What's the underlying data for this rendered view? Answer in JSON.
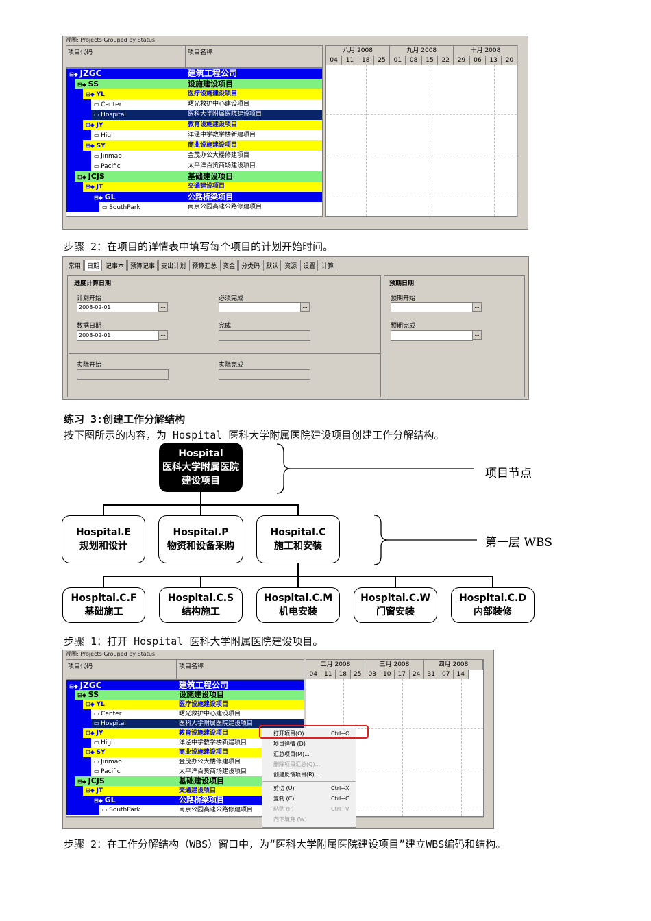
{
  "screenshot1": {
    "title": "视图: Projects Grouped by Status",
    "col_code": "项目代码",
    "col_name": "项目名称",
    "months": [
      "八月 2008",
      "九月 2008",
      "十月 2008"
    ],
    "days": [
      "04",
      "11",
      "18",
      "25",
      "01",
      "08",
      "15",
      "22",
      "29",
      "06",
      "13",
      "20"
    ],
    "rows": [
      {
        "code": "JZGC",
        "name": "建筑工程公司",
        "style": "blue",
        "level": 0
      },
      {
        "code": "SS",
        "name": "设施建设项目",
        "style": "green",
        "level": 1
      },
      {
        "code": "YL",
        "name": "医疗设施建设项目",
        "style": "yellow",
        "level": 2
      },
      {
        "code": "Center",
        "name": "曙光救护中心建设项目",
        "style": "white",
        "level": 3
      },
      {
        "code": "Hospital",
        "name": "医科大学附属医院建设项目",
        "style": "sel",
        "level": 3
      },
      {
        "code": "JY",
        "name": "教育设施建设项目",
        "style": "yellow",
        "level": 2
      },
      {
        "code": "High",
        "name": "洋泾中学教学楼新建项目",
        "style": "white",
        "level": 3
      },
      {
        "code": "SY",
        "name": "商业设施建设项目",
        "style": "yellow",
        "level": 2
      },
      {
        "code": "Jinmao",
        "name": "金茂办公大楼修建项目",
        "style": "white",
        "level": 3
      },
      {
        "code": "Pacific",
        "name": "太平洋百货商场建设项目",
        "style": "white",
        "level": 3
      },
      {
        "code": "JCJS",
        "name": "基础建设项目",
        "style": "green",
        "level": 1
      },
      {
        "code": "JT",
        "name": "交通建设项目",
        "style": "yellow",
        "level": 2
      },
      {
        "code": "GL",
        "name": "公路桥梁项目",
        "style": "blue",
        "level": 3
      },
      {
        "code": "SouthPark",
        "name": "南京公园高速公路修建项目",
        "style": "white",
        "level": 4
      }
    ]
  },
  "step2_text": "步骤 2：在项目的详情表中填写每个项目的计划开始时间。",
  "details": {
    "tabs": [
      "常用",
      "日期",
      "记事本",
      "预算记事",
      "支出计划",
      "预算汇总",
      "资金",
      "分类码",
      "默认",
      "资源",
      "设置",
      "计算"
    ],
    "active_tab": "日期",
    "section_schedule": "进度计算日期",
    "section_expected": "预期日期",
    "plan_start_label": "计划开始",
    "plan_start_value": "2008-02-01",
    "must_finish_label": "必须完成",
    "data_date_label": "数据日期",
    "data_date_value": "2008-02-01",
    "finish_label": "完成",
    "actual_start_label": "实际开始",
    "actual_finish_label": "实际完成",
    "expected_start_label": "预期开始",
    "expected_finish_label": "预期完成",
    "ellipsis": "..."
  },
  "exercise_title": "练习 3:创建工作分解结构",
  "exercise_desc": "按下图所示的内容，为 Hospital 医科大学附属医院建设项目创建工作分解结构。",
  "wbs": {
    "root": [
      "Hospital",
      "医科大学附属医院",
      "建设项目"
    ],
    "level1": [
      [
        "Hospital.E",
        "规划和设计"
      ],
      [
        "Hospital.P",
        "物资和设备采购"
      ],
      [
        "Hospital.C",
        "施工和安装"
      ]
    ],
    "level2": [
      [
        "Hospital.C.F",
        "基础施工"
      ],
      [
        "Hospital.C.S",
        "结构施工"
      ],
      [
        "Hospital.C.M",
        "机电安装"
      ],
      [
        "Hospital.C.W",
        "门窗安装"
      ],
      [
        "Hospital.C.D",
        "内部装修"
      ]
    ],
    "label_root": "项目节点",
    "label_level1": "第一层 WBS"
  },
  "step1_text": "步骤 1：打开 Hospital 医科大学附属医院建设项目。",
  "screenshot2": {
    "title": "视图: Projects Grouped by Status",
    "months": [
      "二月 2008",
      "三月 2008",
      "四月 2008"
    ],
    "days": [
      "04",
      "11",
      "18",
      "25",
      "03",
      "10",
      "17",
      "24",
      "31",
      "07",
      "14"
    ],
    "menu": [
      {
        "label": "打开项目(O)",
        "shortcut": "Ctrl+O",
        "disabled": false
      },
      {
        "label": "项目详情 (D)",
        "shortcut": "",
        "disabled": false
      },
      {
        "label": "汇总项目(M)...",
        "shortcut": "",
        "disabled": false
      },
      {
        "label": "删除项目汇总(Q)...",
        "shortcut": "",
        "disabled": true
      },
      {
        "label": "创建反馈项目(R)...",
        "shortcut": "",
        "disabled": false
      },
      {
        "label": "剪切 (U)",
        "shortcut": "Ctrl+X",
        "disabled": false
      },
      {
        "label": "复制 (C)",
        "shortcut": "Ctrl+C",
        "disabled": false
      },
      {
        "label": "粘贴 (P)",
        "shortcut": "Ctrl+V",
        "disabled": true
      },
      {
        "label": "向下填充 (W)",
        "shortcut": "",
        "disabled": true
      }
    ]
  },
  "step2b_text": "步骤 2：在工作分解结构（WBS）窗口中，为“医科大学附属医院建设项目”建立WBS编码和结构。"
}
